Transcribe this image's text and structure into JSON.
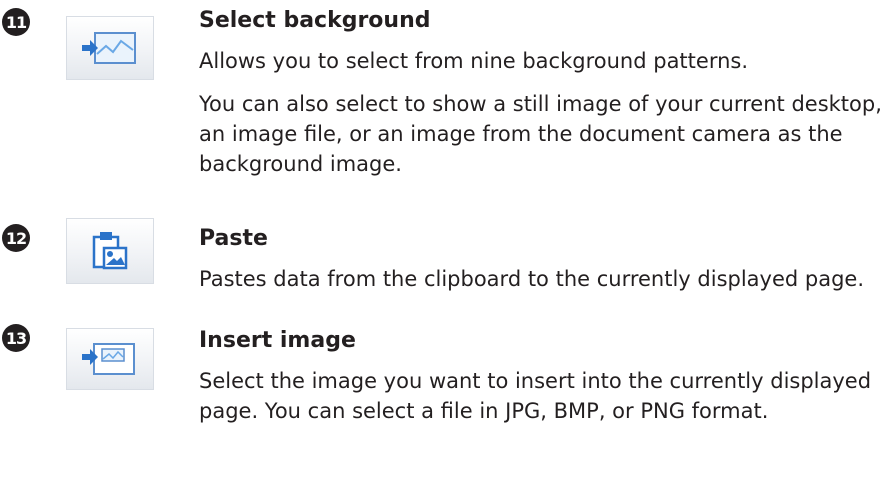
{
  "items": [
    {
      "number": "11",
      "icon": "select-background-icon",
      "title": "Select background",
      "paragraphs": [
        "Allows you to select from nine background patterns.",
        "You can also select to show a still image of your current desktop, an image file, or an image from the document camera as the background image."
      ]
    },
    {
      "number": "12",
      "icon": "paste-icon",
      "title": "Paste",
      "paragraphs": [
        "Pastes data from the clipboard to the currently displayed page."
      ]
    },
    {
      "number": "13",
      "icon": "insert-image-icon",
      "title": "Insert image",
      "paragraphs": [
        "Select the image you want to insert into the currently displayed page. You can select a file in JPG, BMP, or PNG format."
      ]
    }
  ],
  "colors": {
    "text": "#231f20",
    "icon_blue": "#2b73c9",
    "icon_border": "#d8dde4"
  }
}
